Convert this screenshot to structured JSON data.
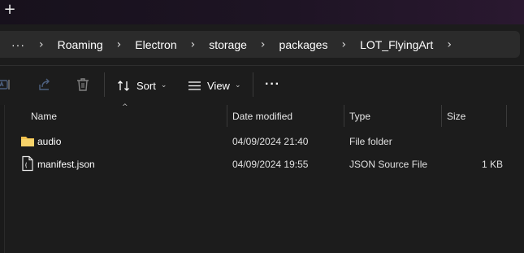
{
  "titlebar": {
    "new_tab_glyph": "+"
  },
  "address_bar": {
    "overflow_glyph": "···",
    "separator": "›",
    "crumbs": [
      "Roaming",
      "Electron",
      "storage",
      "packages",
      "LOT_FlyingArt"
    ]
  },
  "toolbar": {
    "sort_label": "Sort",
    "view_label": "View",
    "more_glyph": "···",
    "chevron": "⌄",
    "icons": [
      "rename-icon",
      "share-icon",
      "delete-icon",
      "sort-icon",
      "view-icon"
    ]
  },
  "columns": {
    "name": "Name",
    "date_modified": "Date modified",
    "type": "Type",
    "size": "Size",
    "sort_caret": "^"
  },
  "files": [
    {
      "name": "audio",
      "date": "04/09/2024 21:40",
      "type": "File folder",
      "size": "",
      "icon": "folder-icon"
    },
    {
      "name": "manifest.json",
      "date": "04/09/2024 19:55",
      "type": "JSON Source File",
      "size": "1 KB",
      "icon": "json-file-icon"
    }
  ],
  "colors": {
    "background": "#1c1c1c",
    "address_bg": "#2b2b2b",
    "folder": "#f2c14e"
  }
}
